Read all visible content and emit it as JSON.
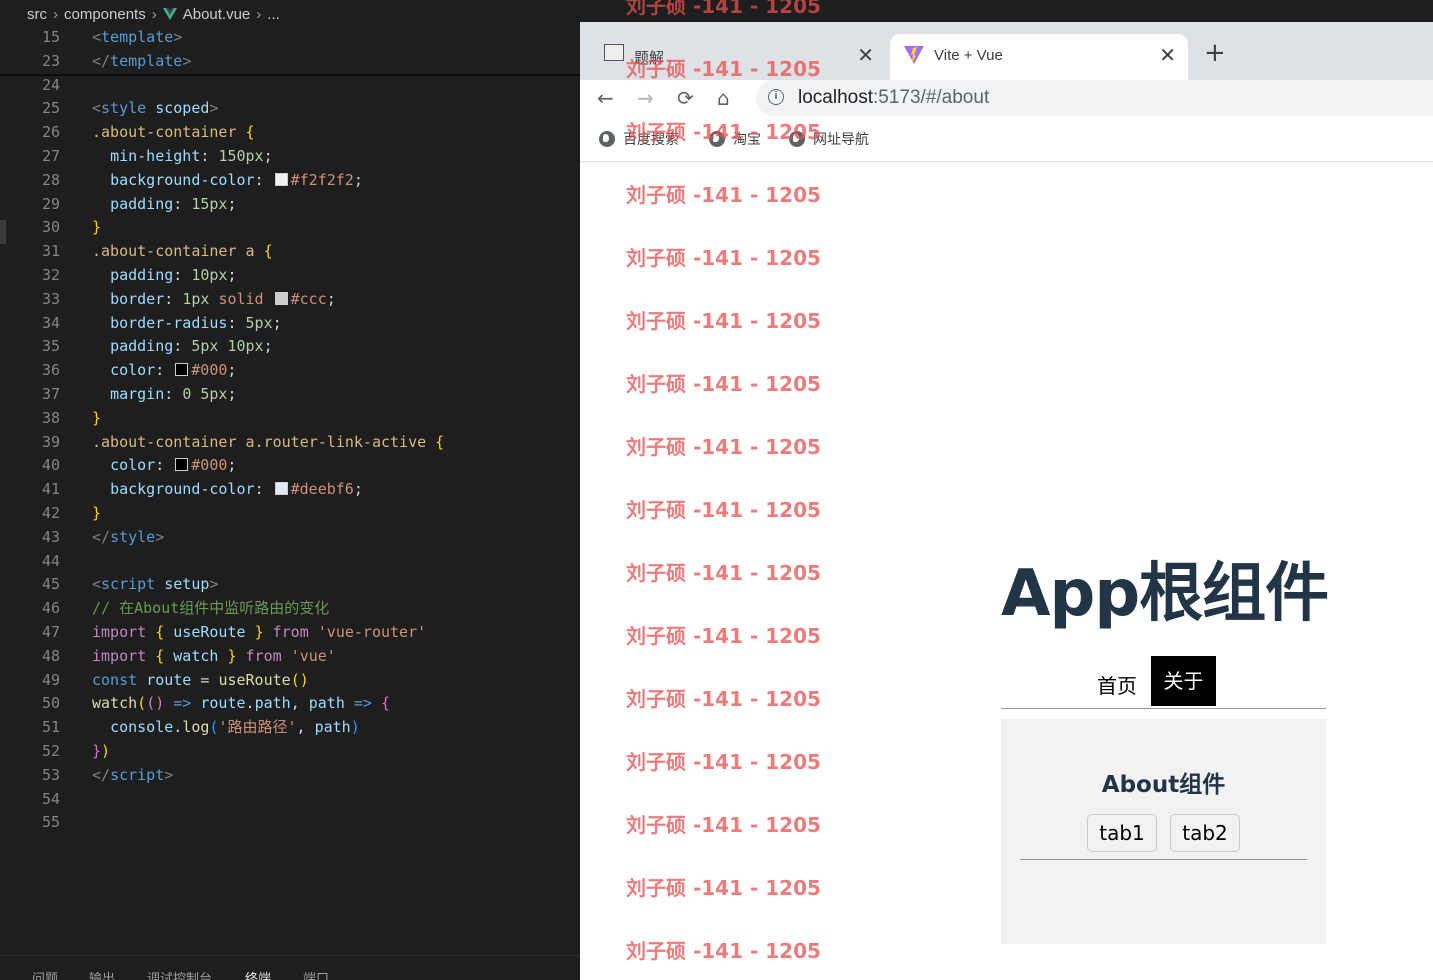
{
  "editor": {
    "breadcrumb": {
      "parts": [
        "src",
        "components",
        "About.vue",
        "..."
      ]
    },
    "lines": [
      {
        "n": "15",
        "code": [
          [
            "c-tag",
            "<"
          ],
          [
            "c-tname",
            "template"
          ],
          [
            "c-tag",
            ">"
          ]
        ]
      },
      {
        "n": "23",
        "code": [
          [
            "c-tag",
            "</"
          ],
          [
            "c-tname",
            "template"
          ],
          [
            "c-tag",
            ">"
          ]
        ]
      },
      {
        "n": "24",
        "code": []
      },
      {
        "n": "25",
        "code": [
          [
            "c-tag",
            "<"
          ],
          [
            "c-tname",
            "style"
          ],
          [
            "",
            " "
          ],
          [
            "c-attr",
            "scoped"
          ],
          [
            "c-tag",
            ">"
          ]
        ]
      },
      {
        "n": "26",
        "code": [
          [
            "c-sel",
            ".about-container"
          ],
          [
            "",
            " "
          ],
          [
            "c-br",
            "{"
          ]
        ]
      },
      {
        "n": "27",
        "code": [
          [
            "",
            "  "
          ],
          [
            "c-prop",
            "min-height"
          ],
          [
            "",
            ": "
          ],
          [
            "c-num",
            "150px"
          ],
          [
            "",
            ";"
          ]
        ]
      },
      {
        "n": "28",
        "code": [
          [
            "",
            "  "
          ],
          [
            "c-prop",
            "background-color"
          ],
          [
            "",
            ": "
          ],
          [
            "swatch",
            "#f2f2f2"
          ],
          [
            "c-val",
            "#f2f2f2"
          ],
          [
            "",
            ";"
          ]
        ]
      },
      {
        "n": "29",
        "code": [
          [
            "",
            "  "
          ],
          [
            "c-prop",
            "padding"
          ],
          [
            "",
            ": "
          ],
          [
            "c-num",
            "15px"
          ],
          [
            "",
            ";"
          ]
        ]
      },
      {
        "n": "30",
        "code": [
          [
            "c-br",
            "}"
          ]
        ]
      },
      {
        "n": "31",
        "code": [
          [
            "c-sel",
            ".about-container a"
          ],
          [
            "",
            " "
          ],
          [
            "c-br",
            "{"
          ]
        ]
      },
      {
        "n": "32",
        "code": [
          [
            "",
            "  "
          ],
          [
            "c-prop",
            "padding"
          ],
          [
            "",
            ": "
          ],
          [
            "c-num",
            "10px"
          ],
          [
            "",
            ";"
          ]
        ]
      },
      {
        "n": "33",
        "code": [
          [
            "",
            "  "
          ],
          [
            "c-prop",
            "border"
          ],
          [
            "",
            ": "
          ],
          [
            "c-num",
            "1px"
          ],
          [
            "",
            " "
          ],
          [
            "c-val",
            "solid"
          ],
          [
            "",
            " "
          ],
          [
            "swatch",
            "#cccccc"
          ],
          [
            "c-val",
            "#ccc"
          ],
          [
            "",
            ";"
          ]
        ]
      },
      {
        "n": "34",
        "code": [
          [
            "",
            "  "
          ],
          [
            "c-prop",
            "border-radius"
          ],
          [
            "",
            ": "
          ],
          [
            "c-num",
            "5px"
          ],
          [
            "",
            ";"
          ]
        ]
      },
      {
        "n": "35",
        "code": [
          [
            "",
            "  "
          ],
          [
            "c-prop",
            "padding"
          ],
          [
            "",
            ": "
          ],
          [
            "c-num",
            "5px 10px"
          ],
          [
            "",
            ";"
          ]
        ]
      },
      {
        "n": "36",
        "code": [
          [
            "",
            "  "
          ],
          [
            "c-prop",
            "color"
          ],
          [
            "",
            ": "
          ],
          [
            "swatch",
            "#000000"
          ],
          [
            "c-val",
            "#000"
          ],
          [
            "",
            ";"
          ]
        ]
      },
      {
        "n": "37",
        "code": [
          [
            "",
            "  "
          ],
          [
            "c-prop",
            "margin"
          ],
          [
            "",
            ": "
          ],
          [
            "c-num",
            "0 5px"
          ],
          [
            "",
            ";"
          ]
        ]
      },
      {
        "n": "38",
        "code": [
          [
            "c-br",
            "}"
          ]
        ]
      },
      {
        "n": "39",
        "code": [
          [
            "c-sel",
            ".about-container a.router-link-active"
          ],
          [
            "",
            " "
          ],
          [
            "c-br",
            "{"
          ]
        ]
      },
      {
        "n": "40",
        "code": [
          [
            "",
            "  "
          ],
          [
            "c-prop",
            "color"
          ],
          [
            "",
            ": "
          ],
          [
            "swatch",
            "#000000"
          ],
          [
            "c-val",
            "#000"
          ],
          [
            "",
            ";"
          ]
        ]
      },
      {
        "n": "41",
        "code": [
          [
            "",
            "  "
          ],
          [
            "c-prop",
            "background-color"
          ],
          [
            "",
            ": "
          ],
          [
            "swatch",
            "#deebf6"
          ],
          [
            "c-val",
            "#deebf6"
          ],
          [
            "",
            ";"
          ]
        ]
      },
      {
        "n": "42",
        "code": [
          [
            "c-br",
            "}"
          ]
        ]
      },
      {
        "n": "43",
        "code": [
          [
            "c-tag",
            "</"
          ],
          [
            "c-tname",
            "style"
          ],
          [
            "c-tag",
            ">"
          ]
        ]
      },
      {
        "n": "44",
        "code": []
      },
      {
        "n": "45",
        "code": [
          [
            "c-tag",
            "<"
          ],
          [
            "c-tname",
            "script"
          ],
          [
            "",
            " "
          ],
          [
            "c-attr",
            "setup"
          ],
          [
            "c-tag",
            ">"
          ]
        ]
      },
      {
        "n": "46",
        "code": [
          [
            "c-com",
            "// 在About组件中监听路由的变化"
          ]
        ]
      },
      {
        "n": "47",
        "code": [
          [
            "c-kw",
            "import"
          ],
          [
            "",
            " "
          ],
          [
            "c-br",
            "{"
          ],
          [
            "",
            " "
          ],
          [
            "c-var",
            "useRoute"
          ],
          [
            "",
            " "
          ],
          [
            "c-br",
            "}"
          ],
          [
            "",
            " "
          ],
          [
            "c-kw",
            "from"
          ],
          [
            "",
            " "
          ],
          [
            "c-str",
            "'vue-router'"
          ]
        ]
      },
      {
        "n": "48",
        "code": [
          [
            "c-kw",
            "import"
          ],
          [
            "",
            " "
          ],
          [
            "c-br",
            "{"
          ],
          [
            "",
            " "
          ],
          [
            "c-var",
            "watch"
          ],
          [
            "",
            " "
          ],
          [
            "c-br",
            "}"
          ],
          [
            "",
            " "
          ],
          [
            "c-kw",
            "from"
          ],
          [
            "",
            " "
          ],
          [
            "c-str",
            "'vue'"
          ]
        ]
      },
      {
        "n": "49",
        "code": [
          [
            "c-kw2",
            "const"
          ],
          [
            "",
            " "
          ],
          [
            "c-var",
            "route"
          ],
          [
            "",
            " = "
          ],
          [
            "c-fn",
            "useRoute"
          ],
          [
            "c-br",
            "()"
          ]
        ]
      },
      {
        "n": "50",
        "code": [
          [
            "c-fn",
            "watch"
          ],
          [
            "c-br",
            "("
          ],
          [
            "c-br2",
            "()"
          ],
          [
            "",
            " "
          ],
          [
            "c-kw2",
            "=>"
          ],
          [
            "",
            " "
          ],
          [
            "c-var",
            "route"
          ],
          [
            "",
            "."
          ],
          [
            "c-var",
            "path"
          ],
          [
            "",
            ", "
          ],
          [
            "c-var",
            "path"
          ],
          [
            "",
            " "
          ],
          [
            "c-kw2",
            "=>"
          ],
          [
            "",
            " "
          ],
          [
            "c-br2",
            "{"
          ]
        ]
      },
      {
        "n": "51",
        "code": [
          [
            "",
            "  "
          ],
          [
            "c-var",
            "console"
          ],
          [
            "",
            "."
          ],
          [
            "c-fn",
            "log"
          ],
          [
            "c-br3",
            "("
          ],
          [
            "c-str",
            "'路由路径'"
          ],
          [
            "",
            ", "
          ],
          [
            "c-var",
            "path"
          ],
          [
            "c-br3",
            ")"
          ]
        ]
      },
      {
        "n": "52",
        "code": [
          [
            "c-br2",
            "}"
          ],
          [
            "c-br",
            ")"
          ]
        ]
      },
      {
        "n": "53",
        "code": [
          [
            "c-tag",
            "</"
          ],
          [
            "c-tname",
            "script"
          ],
          [
            "c-tag",
            ">"
          ]
        ]
      },
      {
        "n": "54",
        "code": []
      },
      {
        "n": "55",
        "code": []
      }
    ],
    "panel_tabs": [
      "问题",
      "输出",
      "调试控制台",
      "终端",
      "端口"
    ]
  },
  "browser": {
    "tabs": [
      {
        "title": "题解",
        "close": "✕"
      },
      {
        "title": "Vite + Vue",
        "close": "✕"
      }
    ],
    "new_tab": "+",
    "nav": {
      "back": "←",
      "forward": "→",
      "reload": "⟳",
      "home": "⌂"
    },
    "url": {
      "host": "localhost",
      "path": ":5173/#/about",
      "info": "i"
    },
    "bookmarks": [
      "百度搜索",
      "淘宝",
      "网址导航"
    ]
  },
  "page": {
    "app_title": "App根组件",
    "nav_home": "首页",
    "nav_about": "关于",
    "about_title": "About组件",
    "tab1": "tab1",
    "tab2": "tab2"
  },
  "watermark": {
    "text": "刘子硕 -141 - 1205",
    "count": 16
  }
}
